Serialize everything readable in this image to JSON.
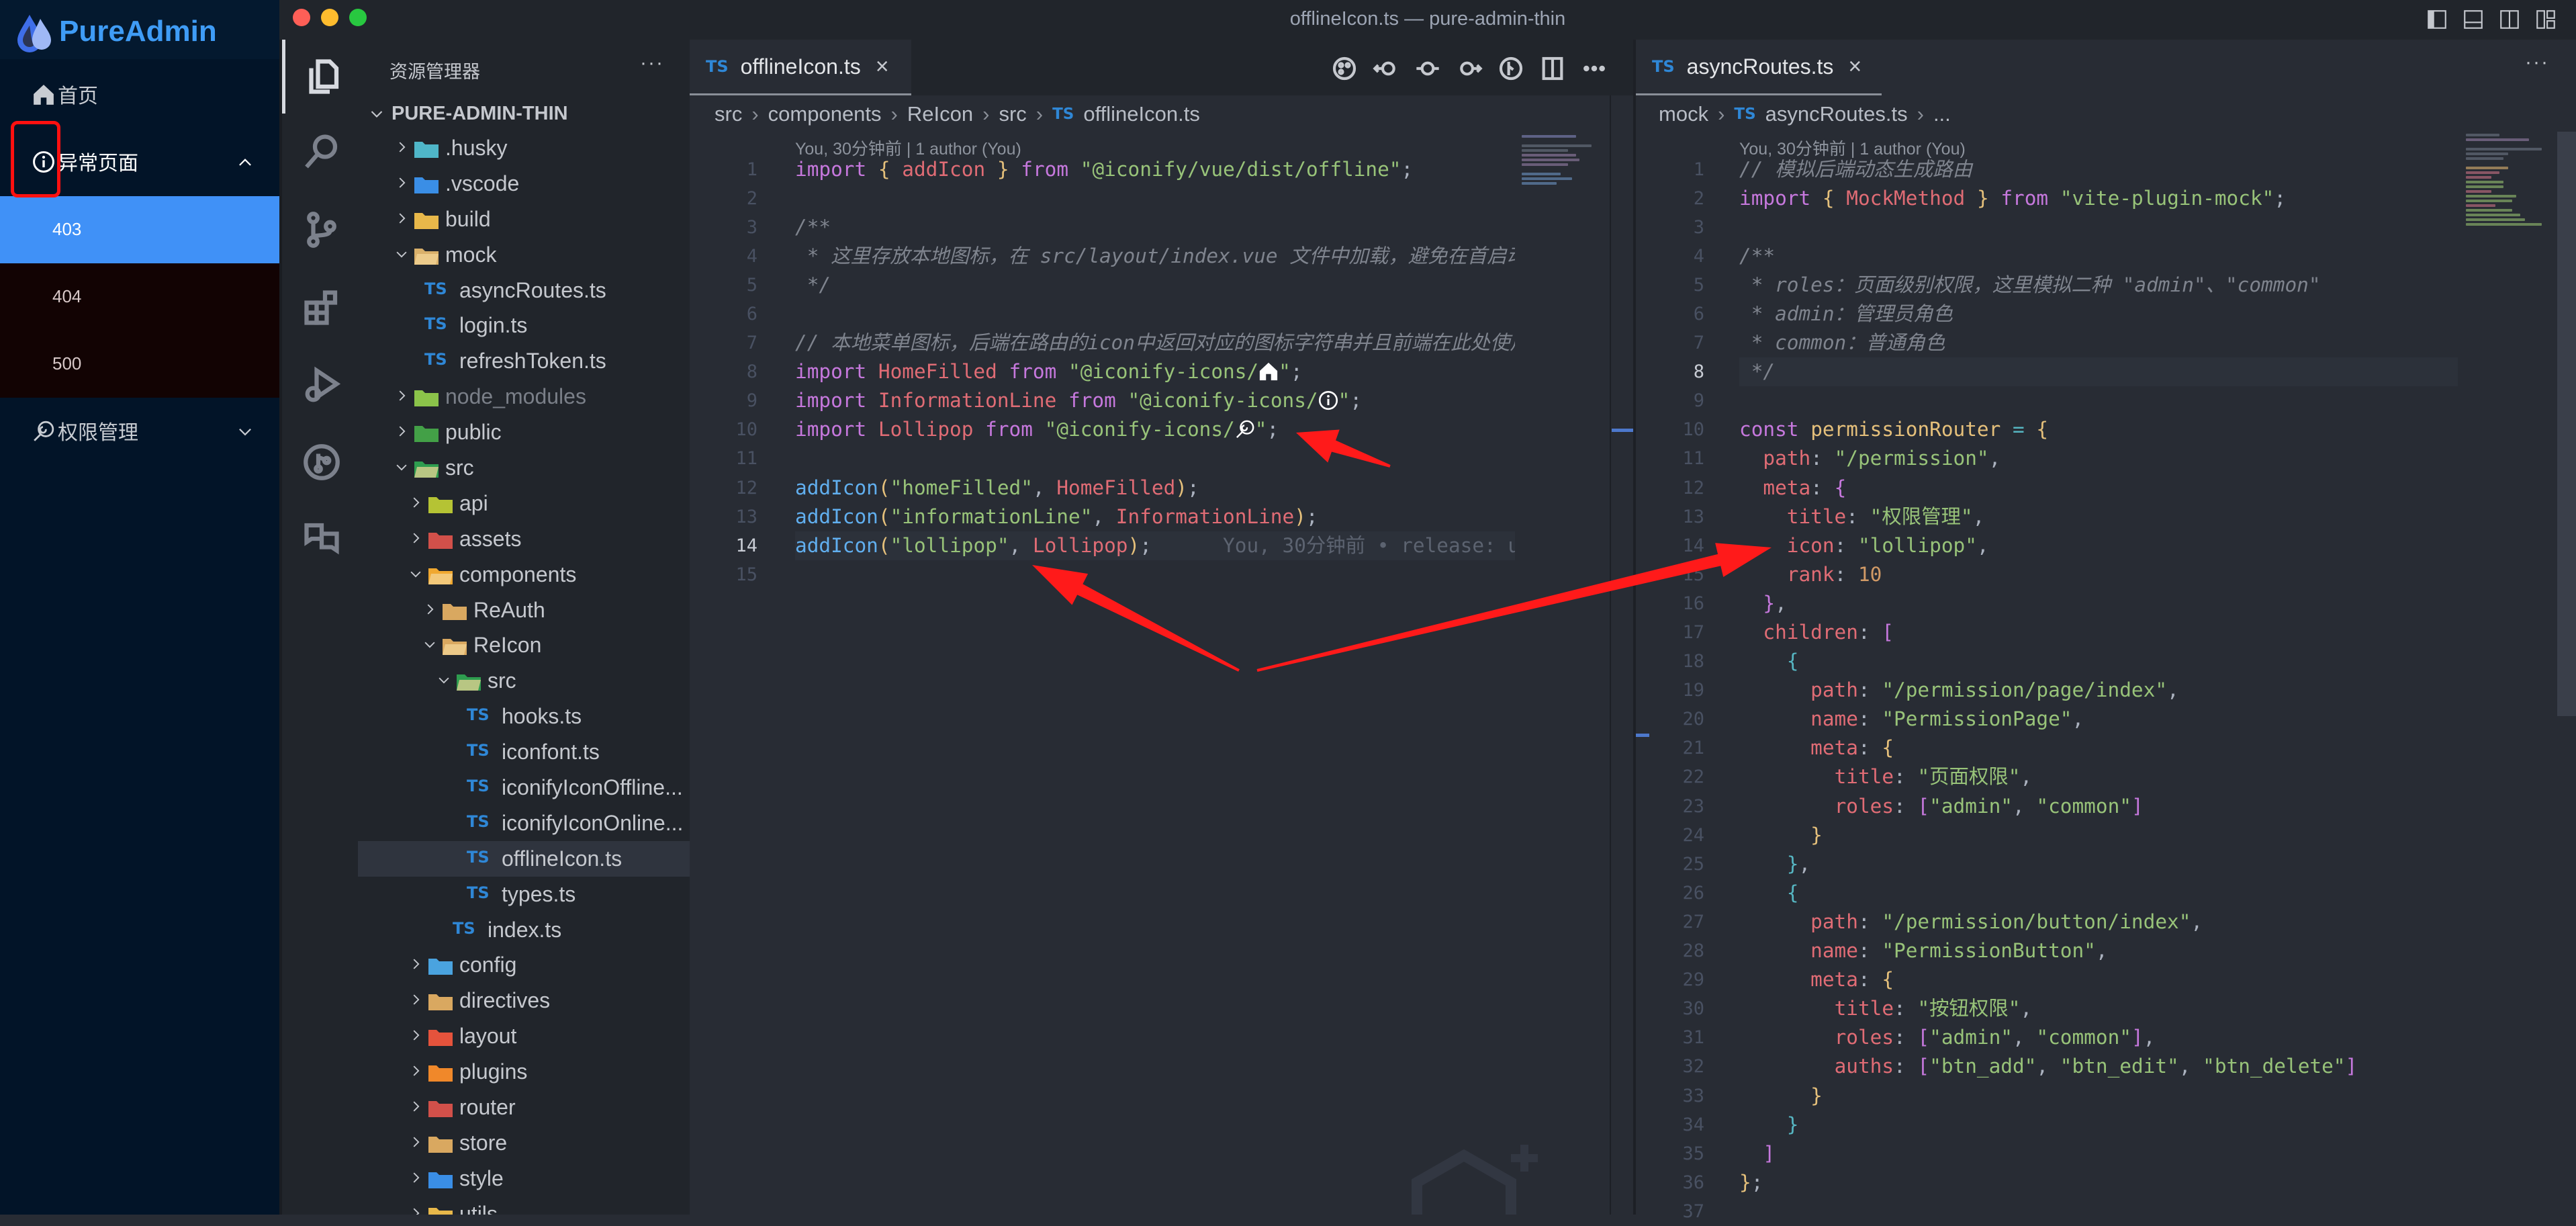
{
  "window": {
    "title": "offlineIcon.ts — pure-admin-thin"
  },
  "admin_sidebar": {
    "logo_text": "PureAdmin",
    "menu": [
      {
        "label": "首页",
        "icon": "home-icon"
      },
      {
        "label": "异常页面",
        "icon": "info-icon",
        "expanded": true,
        "children": [
          "403",
          "404",
          "500"
        ],
        "active_child": "403"
      },
      {
        "label": "权限管理",
        "icon": "lollipop-icon",
        "expanded": false
      }
    ],
    "highlight_box_color": "#ff1010",
    "active_color": "#4091f7"
  },
  "activity_bar": {
    "items": [
      "explorer-icon",
      "search-icon",
      "source-control-icon",
      "extensions-icon",
      "run-debug-icon",
      "git-graph-icon",
      "translate-icon"
    ],
    "active": "explorer-icon"
  },
  "explorer": {
    "title": "资源管理器",
    "more": "···",
    "root": "PURE-ADMIN-THIN",
    "items": [
      {
        "label": ".husky",
        "depth": 1,
        "kind": "folder",
        "open": false,
        "color": "#4fb6c8"
      },
      {
        "label": ".vscode",
        "depth": 1,
        "kind": "folder",
        "open": false,
        "color": "#3a8ee6"
      },
      {
        "label": "build",
        "depth": 1,
        "kind": "folder",
        "open": false,
        "color": "#e8b84a"
      },
      {
        "label": "mock",
        "depth": 1,
        "kind": "folder",
        "open": true,
        "color": "#d9b06a"
      },
      {
        "label": "asyncRoutes.ts",
        "depth": 2,
        "kind": "ts"
      },
      {
        "label": "login.ts",
        "depth": 2,
        "kind": "ts"
      },
      {
        "label": "refreshToken.ts",
        "depth": 2,
        "kind": "ts"
      },
      {
        "label": "node_modules",
        "depth": 1,
        "kind": "folder",
        "open": false,
        "color": "#8bc34a",
        "dim": true
      },
      {
        "label": "public",
        "depth": 1,
        "kind": "folder",
        "open": false,
        "color": "#43a047"
      },
      {
        "label": "src",
        "depth": 1,
        "kind": "folder",
        "open": true,
        "color": "#2e9d4f"
      },
      {
        "label": "api",
        "depth": 2,
        "kind": "folder",
        "open": false,
        "color": "#b5c334"
      },
      {
        "label": "assets",
        "depth": 2,
        "kind": "folder",
        "open": false,
        "color": "#d2504a"
      },
      {
        "label": "components",
        "depth": 2,
        "kind": "folder",
        "open": true,
        "color": "#f0a830"
      },
      {
        "label": "ReAuth",
        "depth": 3,
        "kind": "folder",
        "open": false,
        "color": "#d9a860"
      },
      {
        "label": "ReIcon",
        "depth": 3,
        "kind": "folder",
        "open": true,
        "color": "#d9a860"
      },
      {
        "label": "src",
        "depth": 4,
        "kind": "folder",
        "open": true,
        "color": "#2e9d4f"
      },
      {
        "label": "hooks.ts",
        "depth": 5,
        "kind": "ts"
      },
      {
        "label": "iconfont.ts",
        "depth": 5,
        "kind": "ts"
      },
      {
        "label": "iconifyIconOffline...",
        "depth": 5,
        "kind": "ts"
      },
      {
        "label": "iconifyIconOnline...",
        "depth": 5,
        "kind": "ts"
      },
      {
        "label": "offlineIcon.ts",
        "depth": 5,
        "kind": "ts",
        "selected": true
      },
      {
        "label": "types.ts",
        "depth": 5,
        "kind": "ts"
      },
      {
        "label": "index.ts",
        "depth": 4,
        "kind": "ts"
      },
      {
        "label": "config",
        "depth": 2,
        "kind": "folder",
        "open": false,
        "color": "#4aa3df"
      },
      {
        "label": "directives",
        "depth": 2,
        "kind": "folder",
        "open": false,
        "color": "#d9a860"
      },
      {
        "label": "layout",
        "depth": 2,
        "kind": "folder",
        "open": false,
        "color": "#e5533c"
      },
      {
        "label": "plugins",
        "depth": 2,
        "kind": "folder",
        "open": false,
        "color": "#f0882a"
      },
      {
        "label": "router",
        "depth": 2,
        "kind": "folder",
        "open": false,
        "color": "#d2504a"
      },
      {
        "label": "store",
        "depth": 2,
        "kind": "folder",
        "open": false,
        "color": "#d9a860"
      },
      {
        "label": "style",
        "depth": 2,
        "kind": "folder",
        "open": false,
        "color": "#3a8ee6"
      },
      {
        "label": "utils",
        "depth": 2,
        "kind": "folder",
        "open": false,
        "color": "#e8b84a"
      }
    ]
  },
  "editor_left": {
    "tab": {
      "lang": "TS",
      "label": "offlineIcon.ts",
      "close": "×"
    },
    "toolbar": [
      "color-palette-icon",
      "go-back-icon",
      "git-commit-icon",
      "go-forward-icon",
      "git-lens-icon",
      "split-editor-icon",
      "more-icon"
    ],
    "breadcrumb": [
      "src",
      "components",
      "ReIcon",
      "src"
    ],
    "breadcrumb_file": {
      "lang": "TS",
      "label": "offlineIcon.ts"
    },
    "codelens": "You, 30分钟前 | 1 author (You)",
    "current_line": 14,
    "lines": [
      [
        [
          "kw",
          "import"
        ],
        [
          "p",
          " "
        ],
        [
          "b1",
          "{"
        ],
        [
          "p",
          " "
        ],
        [
          "var",
          "addIcon"
        ],
        [
          "p",
          " "
        ],
        [
          "b1",
          "}"
        ],
        [
          "p",
          " "
        ],
        [
          "kw",
          "from"
        ],
        [
          "p",
          " "
        ],
        [
          "str",
          "\"@iconify/vue/dist/offline\""
        ],
        [
          "p",
          ";"
        ]
      ],
      [],
      [
        [
          "cm",
          "/**"
        ]
      ],
      [
        [
          "cm",
          " * 这里存放本地图标，在 src/layout/index.vue 文件中加载，避免在首启动"
        ]
      ],
      [
        [
          "cm",
          " */"
        ]
      ],
      [],
      [
        [
          "cm",
          "// 本地菜单图标，后端在路由的icon中返回对应的图标字符串并且前端在此处使用"
        ]
      ],
      [
        [
          "kw",
          "import"
        ],
        [
          "p",
          " "
        ],
        [
          "var",
          "HomeFilled"
        ],
        [
          "p",
          " "
        ],
        [
          "kw",
          "from"
        ],
        [
          "p",
          " "
        ],
        [
          "str",
          "\"@iconify-icons/"
        ],
        [
          "icon",
          "home-icon"
        ],
        [
          "str",
          "\""
        ],
        [
          "p",
          ";"
        ]
      ],
      [
        [
          "kw",
          "import"
        ],
        [
          "p",
          " "
        ],
        [
          "var",
          "InformationLine"
        ],
        [
          "p",
          " "
        ],
        [
          "kw",
          "from"
        ],
        [
          "p",
          " "
        ],
        [
          "str",
          "\"@iconify-icons/"
        ],
        [
          "icon",
          "info-icon"
        ],
        [
          "str",
          "\""
        ],
        [
          "p",
          ";"
        ]
      ],
      [
        [
          "kw",
          "import"
        ],
        [
          "p",
          " "
        ],
        [
          "var",
          "Lollipop"
        ],
        [
          "p",
          " "
        ],
        [
          "kw",
          "from"
        ],
        [
          "p",
          " "
        ],
        [
          "str",
          "\"@iconify-icons/"
        ],
        [
          "icon",
          "lollipop-icon"
        ],
        [
          "str",
          "\""
        ],
        [
          "p",
          ";"
        ]
      ],
      [],
      [
        [
          "fn",
          "addIcon"
        ],
        [
          "b1",
          "("
        ],
        [
          "str",
          "\"homeFilled\""
        ],
        [
          "p",
          ", "
        ],
        [
          "var",
          "HomeFilled"
        ],
        [
          "b1",
          ")"
        ],
        [
          "p",
          ";"
        ]
      ],
      [
        [
          "fn",
          "addIcon"
        ],
        [
          "b1",
          "("
        ],
        [
          "str",
          "\"informationLine\""
        ],
        [
          "p",
          ", "
        ],
        [
          "var",
          "InformationLine"
        ],
        [
          "b1",
          ")"
        ],
        [
          "p",
          ";"
        ]
      ],
      [
        [
          "fn",
          "addIcon"
        ],
        [
          "b1",
          "("
        ],
        [
          "str",
          "\"lollipop\""
        ],
        [
          "p",
          ", "
        ],
        [
          "var",
          "Lollipop"
        ],
        [
          "b1",
          ")"
        ],
        [
          "p",
          ";"
        ],
        [
          "blame",
          "      You, 30分钟前 • release: u"
        ]
      ],
      []
    ]
  },
  "editor_right": {
    "tab": {
      "lang": "TS",
      "label": "asyncRoutes.ts",
      "close": "×"
    },
    "more": "···",
    "breadcrumb": [
      "mock"
    ],
    "breadcrumb_file": {
      "lang": "TS",
      "label": "asyncRoutes.ts"
    },
    "breadcrumb_tail": "...",
    "codelens": "You, 30分钟前 | 1 author (You)",
    "current_line": 8,
    "lines": [
      [
        [
          "cm",
          "// 模拟后端动态生成路由"
        ]
      ],
      [
        [
          "kw",
          "import"
        ],
        [
          "p",
          " "
        ],
        [
          "b1",
          "{"
        ],
        [
          "p",
          " "
        ],
        [
          "var",
          "MockMethod"
        ],
        [
          "p",
          " "
        ],
        [
          "b1",
          "}"
        ],
        [
          "p",
          " "
        ],
        [
          "kw",
          "from"
        ],
        [
          "p",
          " "
        ],
        [
          "str",
          "\"vite-plugin-mock\""
        ],
        [
          "p",
          ";"
        ]
      ],
      [],
      [
        [
          "cm",
          "/**"
        ]
      ],
      [
        [
          "cm",
          " * roles：页面级别权限，这里模拟二种 \"admin\"、\"common\""
        ]
      ],
      [
        [
          "cm",
          " * admin：管理员角色"
        ]
      ],
      [
        [
          "cm",
          " * common：普通角色"
        ]
      ],
      [
        [
          "cm",
          " */"
        ]
      ],
      [],
      [
        [
          "kw",
          "const"
        ],
        [
          "p",
          " "
        ],
        [
          "const",
          "permissionRouter"
        ],
        [
          "p",
          " "
        ],
        [
          "op",
          "="
        ],
        [
          "p",
          " "
        ],
        [
          "b1",
          "{"
        ]
      ],
      [
        [
          "p",
          "  "
        ],
        [
          "prop",
          "path"
        ],
        [
          "p",
          ": "
        ],
        [
          "str",
          "\"/permission\""
        ],
        [
          "p",
          ","
        ]
      ],
      [
        [
          "p",
          "  "
        ],
        [
          "prop",
          "meta"
        ],
        [
          "p",
          ": "
        ],
        [
          "b2",
          "{"
        ]
      ],
      [
        [
          "p",
          "    "
        ],
        [
          "prop",
          "title"
        ],
        [
          "p",
          ": "
        ],
        [
          "str",
          "\"权限管理\""
        ],
        [
          "p",
          ","
        ]
      ],
      [
        [
          "p",
          "    "
        ],
        [
          "prop",
          "icon"
        ],
        [
          "p",
          ": "
        ],
        [
          "str",
          "\"lollipop\""
        ],
        [
          "p",
          ","
        ]
      ],
      [
        [
          "p",
          "    "
        ],
        [
          "prop",
          "rank"
        ],
        [
          "p",
          ": "
        ],
        [
          "num",
          "10"
        ]
      ],
      [
        [
          "p",
          "  "
        ],
        [
          "b2",
          "}"
        ],
        [
          "p",
          ","
        ]
      ],
      [
        [
          "p",
          "  "
        ],
        [
          "prop",
          "children"
        ],
        [
          "p",
          ": "
        ],
        [
          "b2",
          "["
        ]
      ],
      [
        [
          "p",
          "    "
        ],
        [
          "b3",
          "{"
        ]
      ],
      [
        [
          "p",
          "      "
        ],
        [
          "prop",
          "path"
        ],
        [
          "p",
          ": "
        ],
        [
          "str",
          "\"/permission/page/index\""
        ],
        [
          "p",
          ","
        ]
      ],
      [
        [
          "p",
          "      "
        ],
        [
          "prop",
          "name"
        ],
        [
          "p",
          ": "
        ],
        [
          "str",
          "\"PermissionPage\""
        ],
        [
          "p",
          ","
        ]
      ],
      [
        [
          "p",
          "      "
        ],
        [
          "prop",
          "meta"
        ],
        [
          "p",
          ": "
        ],
        [
          "b1",
          "{"
        ]
      ],
      [
        [
          "p",
          "        "
        ],
        [
          "prop",
          "title"
        ],
        [
          "p",
          ": "
        ],
        [
          "str",
          "\"页面权限\""
        ],
        [
          "p",
          ","
        ]
      ],
      [
        [
          "p",
          "        "
        ],
        [
          "prop",
          "roles"
        ],
        [
          "p",
          ": "
        ],
        [
          "b2",
          "["
        ],
        [
          "str",
          "\"admin\""
        ],
        [
          "p",
          ", "
        ],
        [
          "str",
          "\"common\""
        ],
        [
          "b2",
          "]"
        ]
      ],
      [
        [
          "p",
          "      "
        ],
        [
          "b1",
          "}"
        ]
      ],
      [
        [
          "p",
          "    "
        ],
        [
          "b3",
          "}"
        ],
        [
          "p",
          ","
        ]
      ],
      [
        [
          "p",
          "    "
        ],
        [
          "b3",
          "{"
        ]
      ],
      [
        [
          "p",
          "      "
        ],
        [
          "prop",
          "path"
        ],
        [
          "p",
          ": "
        ],
        [
          "str",
          "\"/permission/button/index\""
        ],
        [
          "p",
          ","
        ]
      ],
      [
        [
          "p",
          "      "
        ],
        [
          "prop",
          "name"
        ],
        [
          "p",
          ": "
        ],
        [
          "str",
          "\"PermissionButton\""
        ],
        [
          "p",
          ","
        ]
      ],
      [
        [
          "p",
          "      "
        ],
        [
          "prop",
          "meta"
        ],
        [
          "p",
          ": "
        ],
        [
          "b1",
          "{"
        ]
      ],
      [
        [
          "p",
          "        "
        ],
        [
          "prop",
          "title"
        ],
        [
          "p",
          ": "
        ],
        [
          "str",
          "\"按钮权限\""
        ],
        [
          "p",
          ","
        ]
      ],
      [
        [
          "p",
          "        "
        ],
        [
          "prop",
          "roles"
        ],
        [
          "p",
          ": "
        ],
        [
          "b2",
          "["
        ],
        [
          "str",
          "\"admin\""
        ],
        [
          "p",
          ", "
        ],
        [
          "str",
          "\"common\""
        ],
        [
          "b2",
          "]"
        ],
        [
          "p",
          ","
        ]
      ],
      [
        [
          "p",
          "        "
        ],
        [
          "prop",
          "auths"
        ],
        [
          "p",
          ": "
        ],
        [
          "b2",
          "["
        ],
        [
          "str",
          "\"btn_add\""
        ],
        [
          "p",
          ", "
        ],
        [
          "str",
          "\"btn_edit\""
        ],
        [
          "p",
          ", "
        ],
        [
          "str",
          "\"btn_delete\""
        ],
        [
          "b2",
          "]"
        ]
      ],
      [
        [
          "p",
          "      "
        ],
        [
          "b1",
          "}"
        ]
      ],
      [
        [
          "p",
          "    "
        ],
        [
          "b3",
          "}"
        ]
      ],
      [
        [
          "p",
          "  "
        ],
        [
          "b2",
          "]"
        ]
      ],
      [
        [
          "b1",
          "}"
        ],
        [
          "p",
          ";"
        ]
      ],
      []
    ]
  },
  "annotations": {
    "arrow_color": "#ff1a1a"
  },
  "layout_controls": [
    "toggle-sidebar-icon",
    "toggle-panel-icon",
    "toggle-secondary-sidebar-icon",
    "customize-layout-icon"
  ]
}
